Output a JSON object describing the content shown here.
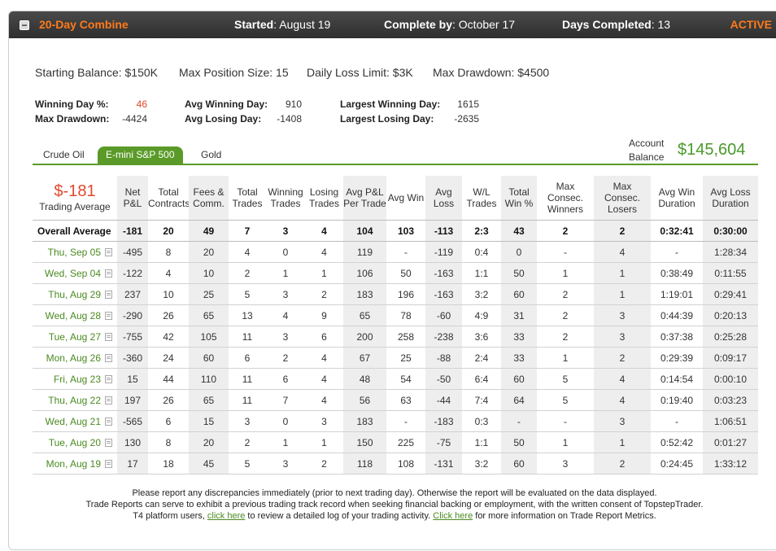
{
  "header": {
    "collapse_label": "−",
    "title": "20-Day Combine",
    "started_label": "Started",
    "started_value": ": August 19",
    "complete_label": "Complete by",
    "complete_value": ": October 17",
    "days_label": "Days Completed",
    "days_value": ": 13",
    "status": "ACTIVE"
  },
  "rules": {
    "starting_balance": "Starting Balance: $150K",
    "max_position": "Max Position Size: 15",
    "daily_loss": "Daily Loss Limit: $3K",
    "max_drawdown": "Max Drawdown: $4500"
  },
  "stats": {
    "winning_day_label": "Winning Day %:",
    "winning_day_value": "46",
    "max_drawdown_label": "Max Drawdown:",
    "max_drawdown_value": "-4424",
    "avg_winning_day_label": "Avg Winning Day:",
    "avg_winning_day_value": "910",
    "avg_losing_day_label": "Avg Losing Day:",
    "avg_losing_day_value": "-1408",
    "largest_winning_day_label": "Largest Winning Day:",
    "largest_winning_day_value": "1615",
    "largest_losing_day_label": "Largest Losing Day:",
    "largest_losing_day_value": "-2635"
  },
  "tabs": [
    "Crude Oil",
    "E-mini S&P 500",
    "Gold"
  ],
  "active_tab": "E-mini S&P 500",
  "account": {
    "label": "Account Balance",
    "balance": "$145,604"
  },
  "table": {
    "trading_average_value": "$-181",
    "trading_average_label": "Trading Average",
    "columns": [
      "Net P&L",
      "Total Contracts",
      "Fees & Comm.",
      "Total Trades",
      "Winning Trades",
      "Losing Trades",
      "Avg P&L Per Trade",
      "Avg Win",
      "Avg Loss",
      "W/L Trades",
      "Total Win %",
      "Max Consec. Winners",
      "Max Consec. Losers",
      "Avg Win Duration",
      "Avg Loss Duration"
    ],
    "overall": [
      "Overall Average",
      "-181",
      "20",
      "49",
      "7",
      "3",
      "4",
      "104",
      "103",
      "-113",
      "2:3",
      "43",
      "2",
      "2",
      "0:32:41",
      "0:30:00"
    ],
    "rows": [
      [
        "Thu, Sep 05",
        "-495",
        "8",
        "20",
        "4",
        "0",
        "4",
        "119",
        "-",
        "-119",
        "0:4",
        "0",
        "-",
        "4",
        "-",
        "1:28:34"
      ],
      [
        "Wed, Sep 04",
        "-122",
        "4",
        "10",
        "2",
        "1",
        "1",
        "106",
        "50",
        "-163",
        "1:1",
        "50",
        "1",
        "1",
        "0:38:49",
        "0:11:55"
      ],
      [
        "Thu, Aug 29",
        "237",
        "10",
        "25",
        "5",
        "3",
        "2",
        "183",
        "196",
        "-163",
        "3:2",
        "60",
        "2",
        "1",
        "1:19:01",
        "0:29:41"
      ],
      [
        "Wed, Aug 28",
        "-290",
        "26",
        "65",
        "13",
        "4",
        "9",
        "65",
        "78",
        "-60",
        "4:9",
        "31",
        "2",
        "3",
        "0:44:39",
        "0:20:13"
      ],
      [
        "Tue, Aug 27",
        "-755",
        "42",
        "105",
        "11",
        "3",
        "6",
        "200",
        "258",
        "-238",
        "3:6",
        "33",
        "2",
        "3",
        "0:37:38",
        "0:25:28"
      ],
      [
        "Mon, Aug 26",
        "-360",
        "24",
        "60",
        "6",
        "2",
        "4",
        "67",
        "25",
        "-88",
        "2:4",
        "33",
        "1",
        "2",
        "0:29:39",
        "0:09:17"
      ],
      [
        "Fri, Aug 23",
        "15",
        "44",
        "110",
        "11",
        "6",
        "4",
        "48",
        "54",
        "-50",
        "6:4",
        "60",
        "5",
        "4",
        "0:14:54",
        "0:00:10"
      ],
      [
        "Thu, Aug 22",
        "197",
        "26",
        "65",
        "11",
        "7",
        "4",
        "56",
        "63",
        "-44",
        "7:4",
        "64",
        "5",
        "4",
        "0:19:40",
        "0:03:23"
      ],
      [
        "Wed, Aug 21",
        "-565",
        "6",
        "15",
        "3",
        "0",
        "3",
        "183",
        "-",
        "-183",
        "0:3",
        "-",
        "-",
        "3",
        "-",
        "1:06:51"
      ],
      [
        "Tue, Aug 20",
        "130",
        "8",
        "20",
        "2",
        "1",
        "1",
        "150",
        "225",
        "-75",
        "1:1",
        "50",
        "1",
        "1",
        "0:52:42",
        "0:01:27"
      ],
      [
        "Mon, Aug 19",
        "17",
        "18",
        "45",
        "5",
        "3",
        "2",
        "118",
        "108",
        "-131",
        "3:2",
        "60",
        "3",
        "2",
        "0:24:45",
        "1:33:12"
      ]
    ]
  },
  "footer": {
    "line1": "Please report any discrepancies immediately (prior to next trading day). Otherwise the report will be evaluated on the data displayed.",
    "line2": "Trade Reports can serve to exhibit a previous trading track record when seeking financial backing or employment, with the written consent of TopstepTrader.",
    "line3_pre": "T4 platform users, ",
    "line3_link1": "click here",
    "line3_mid": " to review a detailed log of your trading activity. ",
    "line3_link2": "Click here",
    "line3_post": " for more information on Trade Report Metrics."
  }
}
